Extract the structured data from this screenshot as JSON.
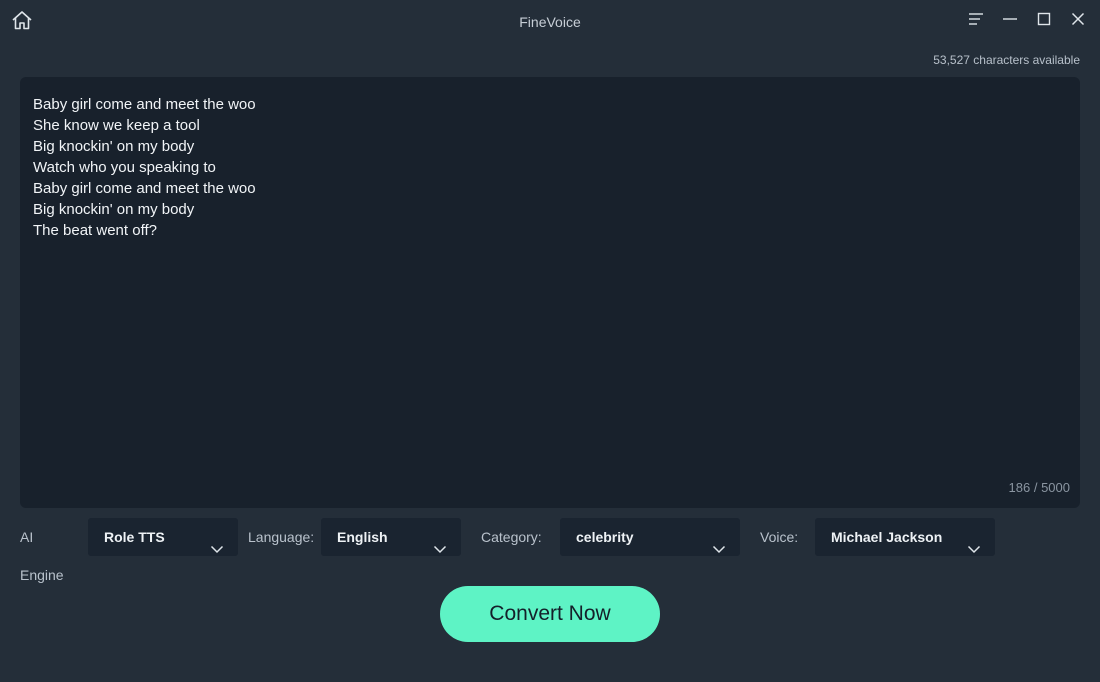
{
  "window": {
    "title": "FineVoice",
    "icons": {
      "home": "home-icon",
      "menu": "menu-icon",
      "minimize": "minimize-icon",
      "maximize": "maximize-icon",
      "close": "close-icon"
    }
  },
  "quota": {
    "text": "53,527 characters available"
  },
  "editor": {
    "text": "Baby girl come and meet the woo\nShe know we keep a tool\nBig knockin' on my body\nWatch who you speaking to\nBaby girl come and meet the woo\nBig knockin' on my body\nThe beat went off?",
    "counter": "186 / 5000"
  },
  "controls": {
    "ai_engine_label": "AI Engine",
    "ai_engine_value": "Role TTS",
    "language_label": "Language:",
    "language_value": "English",
    "category_label": "Category:",
    "category_value": "celebrity",
    "voice_label": "Voice:",
    "voice_value": "Michael Jackson"
  },
  "actions": {
    "convert_label": "Convert Now"
  },
  "colors": {
    "background": "#242e39",
    "editor_background": "#18212c",
    "select_background": "#1a2430",
    "accent": "#5ef3c5"
  }
}
